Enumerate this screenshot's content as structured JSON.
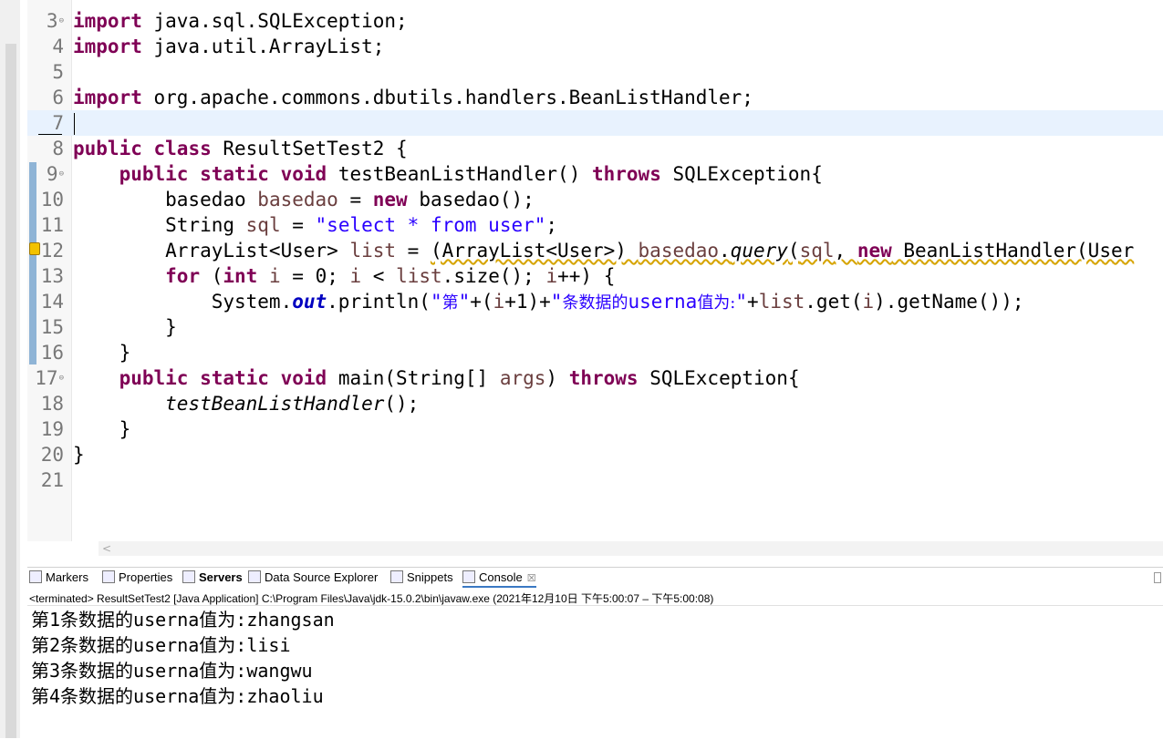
{
  "editor": {
    "lines": [
      {
        "n": "3",
        "fold": true,
        "segments": [
          {
            "t": "import",
            "c": "kw"
          },
          {
            "t": " java.sql.SQLException;",
            "c": ""
          }
        ]
      },
      {
        "n": "4",
        "segments": [
          {
            "t": "import",
            "c": "kw"
          },
          {
            "t": " java.util.ArrayList;",
            "c": ""
          }
        ]
      },
      {
        "n": "5",
        "segments": []
      },
      {
        "n": "6",
        "segments": [
          {
            "t": "import",
            "c": "kw"
          },
          {
            "t": " org.apache.commons.dbutils.handlers.BeanListHandler;",
            "c": ""
          }
        ]
      },
      {
        "n": "7",
        "current": true,
        "segments": []
      },
      {
        "n": "8",
        "segments": [
          {
            "t": "public",
            "c": "kw"
          },
          {
            "t": " ",
            "c": ""
          },
          {
            "t": "class",
            "c": "kw"
          },
          {
            "t": " ResultSetTest2 {",
            "c": ""
          }
        ]
      },
      {
        "n": "9",
        "fold": true,
        "segments": [
          {
            "t": "    ",
            "c": ""
          },
          {
            "t": "public",
            "c": "kw"
          },
          {
            "t": " ",
            "c": ""
          },
          {
            "t": "static",
            "c": "kw"
          },
          {
            "t": " ",
            "c": ""
          },
          {
            "t": "void",
            "c": "kw"
          },
          {
            "t": " testBeanListHandler() ",
            "c": ""
          },
          {
            "t": "throws",
            "c": "kw"
          },
          {
            "t": " SQLException{",
            "c": ""
          }
        ]
      },
      {
        "n": "10",
        "segments": [
          {
            "t": "        basedao ",
            "c": ""
          },
          {
            "t": "basedao",
            "c": "var"
          },
          {
            "t": " = ",
            "c": ""
          },
          {
            "t": "new",
            "c": "kw"
          },
          {
            "t": " basedao();",
            "c": ""
          }
        ]
      },
      {
        "n": "11",
        "segments": [
          {
            "t": "        String ",
            "c": ""
          },
          {
            "t": "sql",
            "c": "var"
          },
          {
            "t": " = ",
            "c": ""
          },
          {
            "t": "\"select * from user\"",
            "c": "str"
          },
          {
            "t": ";",
            "c": ""
          }
        ]
      },
      {
        "n": "12",
        "segments": [
          {
            "t": "        ArrayList<User> ",
            "c": ""
          },
          {
            "t": "list",
            "c": "var"
          },
          {
            "t": " = ",
            "c": ""
          },
          {
            "t": "(ArrayList<User>) ",
            "c": "warn"
          },
          {
            "t": "basedao",
            "c": "var warn"
          },
          {
            "t": ".",
            "c": "warn"
          },
          {
            "t": "query",
            "c": "ital warn"
          },
          {
            "t": "(",
            "c": "warn"
          },
          {
            "t": "sql",
            "c": "var warn"
          },
          {
            "t": ", ",
            "c": "warn"
          },
          {
            "t": "new",
            "c": "kw warn"
          },
          {
            "t": " BeanListHandler(User",
            "c": "warn"
          }
        ]
      },
      {
        "n": "13",
        "segments": [
          {
            "t": "        ",
            "c": ""
          },
          {
            "t": "for",
            "c": "kw"
          },
          {
            "t": " (",
            "c": ""
          },
          {
            "t": "int",
            "c": "kw"
          },
          {
            "t": " ",
            "c": ""
          },
          {
            "t": "i",
            "c": "var"
          },
          {
            "t": " = 0; ",
            "c": ""
          },
          {
            "t": "i",
            "c": "var"
          },
          {
            "t": " < ",
            "c": ""
          },
          {
            "t": "list",
            "c": "var"
          },
          {
            "t": ".size(); ",
            "c": ""
          },
          {
            "t": "i",
            "c": "var"
          },
          {
            "t": "++) {",
            "c": ""
          }
        ]
      },
      {
        "n": "14",
        "segments": [
          {
            "t": "            System.",
            "c": ""
          },
          {
            "t": "out",
            "c": "fld"
          },
          {
            "t": ".println(",
            "c": ""
          },
          {
            "t": "\"",
            "c": "str"
          },
          {
            "t": "第",
            "c": "str cn"
          },
          {
            "t": "\"",
            "c": "str"
          },
          {
            "t": "+(",
            "c": ""
          },
          {
            "t": "i",
            "c": "var"
          },
          {
            "t": "+1)+",
            "c": ""
          },
          {
            "t": "\"",
            "c": "str"
          },
          {
            "t": "条数据的",
            "c": "str cn"
          },
          {
            "t": "userna",
            "c": "str"
          },
          {
            "t": "值为:",
            "c": "str cn"
          },
          {
            "t": "\"",
            "c": "str"
          },
          {
            "t": "+",
            "c": ""
          },
          {
            "t": "list",
            "c": "var"
          },
          {
            "t": ".get(",
            "c": ""
          },
          {
            "t": "i",
            "c": "var"
          },
          {
            "t": ").getName());",
            "c": ""
          }
        ]
      },
      {
        "n": "15",
        "segments": [
          {
            "t": "        }",
            "c": ""
          }
        ]
      },
      {
        "n": "16",
        "segments": [
          {
            "t": "    }",
            "c": ""
          }
        ]
      },
      {
        "n": "17",
        "fold": true,
        "segments": [
          {
            "t": "    ",
            "c": ""
          },
          {
            "t": "public",
            "c": "kw"
          },
          {
            "t": " ",
            "c": ""
          },
          {
            "t": "static",
            "c": "kw"
          },
          {
            "t": " ",
            "c": ""
          },
          {
            "t": "void",
            "c": "kw"
          },
          {
            "t": " main(String[] ",
            "c": ""
          },
          {
            "t": "args",
            "c": "var"
          },
          {
            "t": ") ",
            "c": ""
          },
          {
            "t": "throws",
            "c": "kw"
          },
          {
            "t": " SQLException{",
            "c": ""
          }
        ]
      },
      {
        "n": "18",
        "segments": [
          {
            "t": "        ",
            "c": ""
          },
          {
            "t": "testBeanListHandler",
            "c": "ital"
          },
          {
            "t": "();",
            "c": ""
          }
        ]
      },
      {
        "n": "19",
        "segments": [
          {
            "t": "    }",
            "c": ""
          }
        ]
      },
      {
        "n": "20",
        "segments": [
          {
            "t": "}",
            "c": ""
          }
        ]
      },
      {
        "n": "21",
        "segments": []
      }
    ],
    "fold_glyph": "⊖",
    "hscroll_arrow": "<"
  },
  "views": {
    "tabs": [
      {
        "label": "Markers",
        "icon": "markers-icon"
      },
      {
        "label": "Properties",
        "icon": "properties-icon"
      },
      {
        "label": "Servers",
        "icon": "servers-icon",
        "bold": true
      },
      {
        "label": "Data Source Explorer",
        "icon": "data-source-explorer-icon"
      },
      {
        "label": "Snippets",
        "icon": "snippets-icon"
      },
      {
        "label": "Console",
        "icon": "console-icon",
        "active": true,
        "closable": true
      }
    ],
    "close_glyph": "☒",
    "status": "<terminated> ResultSetTest2 [Java Application] C:\\Program Files\\Java\\jdk-15.0.2\\bin\\javaw.exe  (2021年12月10日 下午5:00:07 – 下午5:00:08)",
    "console_output": [
      "第1条数据的userna值为:zhangsan",
      "第2条数据的userna值为:lisi",
      "第3条数据的userna值为:wangwu",
      "第4条数据的userna值为:zhaoliu"
    ]
  },
  "colors": {
    "keyword": "#7f0055",
    "string": "#2a00ff",
    "variable": "#6a3e3e",
    "field": "#0000c0",
    "current_line": "#e8f2fe"
  }
}
